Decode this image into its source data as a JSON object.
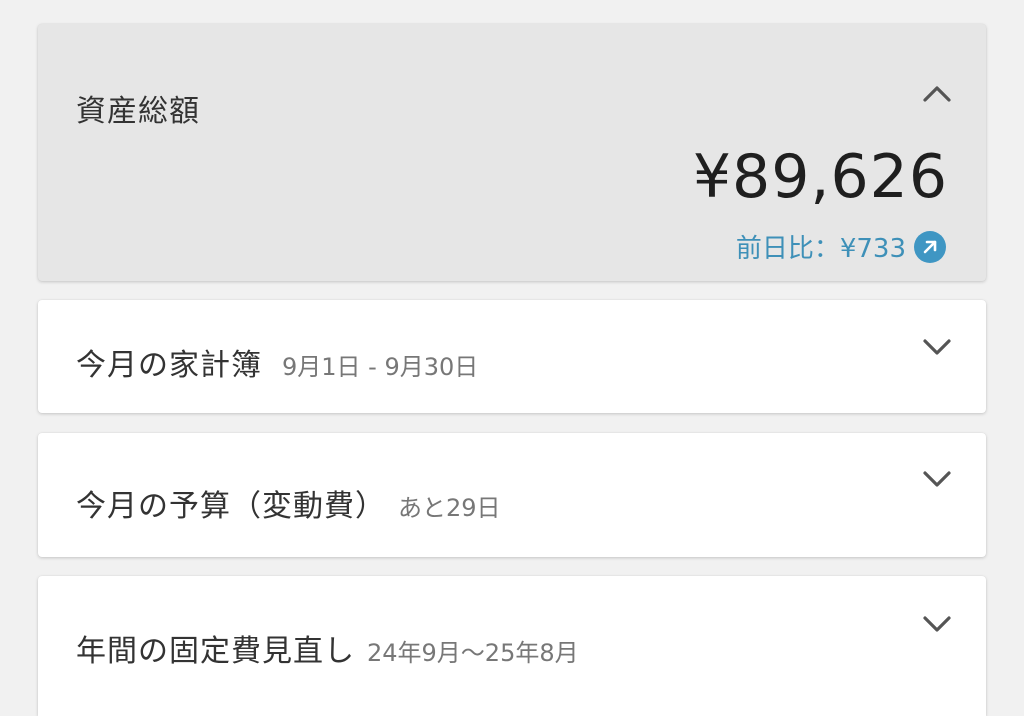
{
  "summary": {
    "title": "資産総額",
    "amount": "¥89,626",
    "diff": "前日比：¥733",
    "diff_icon": "arrow-up-right-circle-icon",
    "accent_color": "#3f96c3"
  },
  "sections": {
    "kakeibo": {
      "title": "今月の家計簿",
      "sub": "9月1日 - 9月30日"
    },
    "budget": {
      "title": "今月の予算（変動費）",
      "sub": "あと29日"
    },
    "fixed": {
      "title": "年間の固定費見直し",
      "sub": "24年9月〜25年8月"
    }
  },
  "colors": {
    "background": "#f1f1f1",
    "summary_card": "#e6e6e6",
    "card": "#ffffff",
    "diff_text": "#3e90b8"
  }
}
